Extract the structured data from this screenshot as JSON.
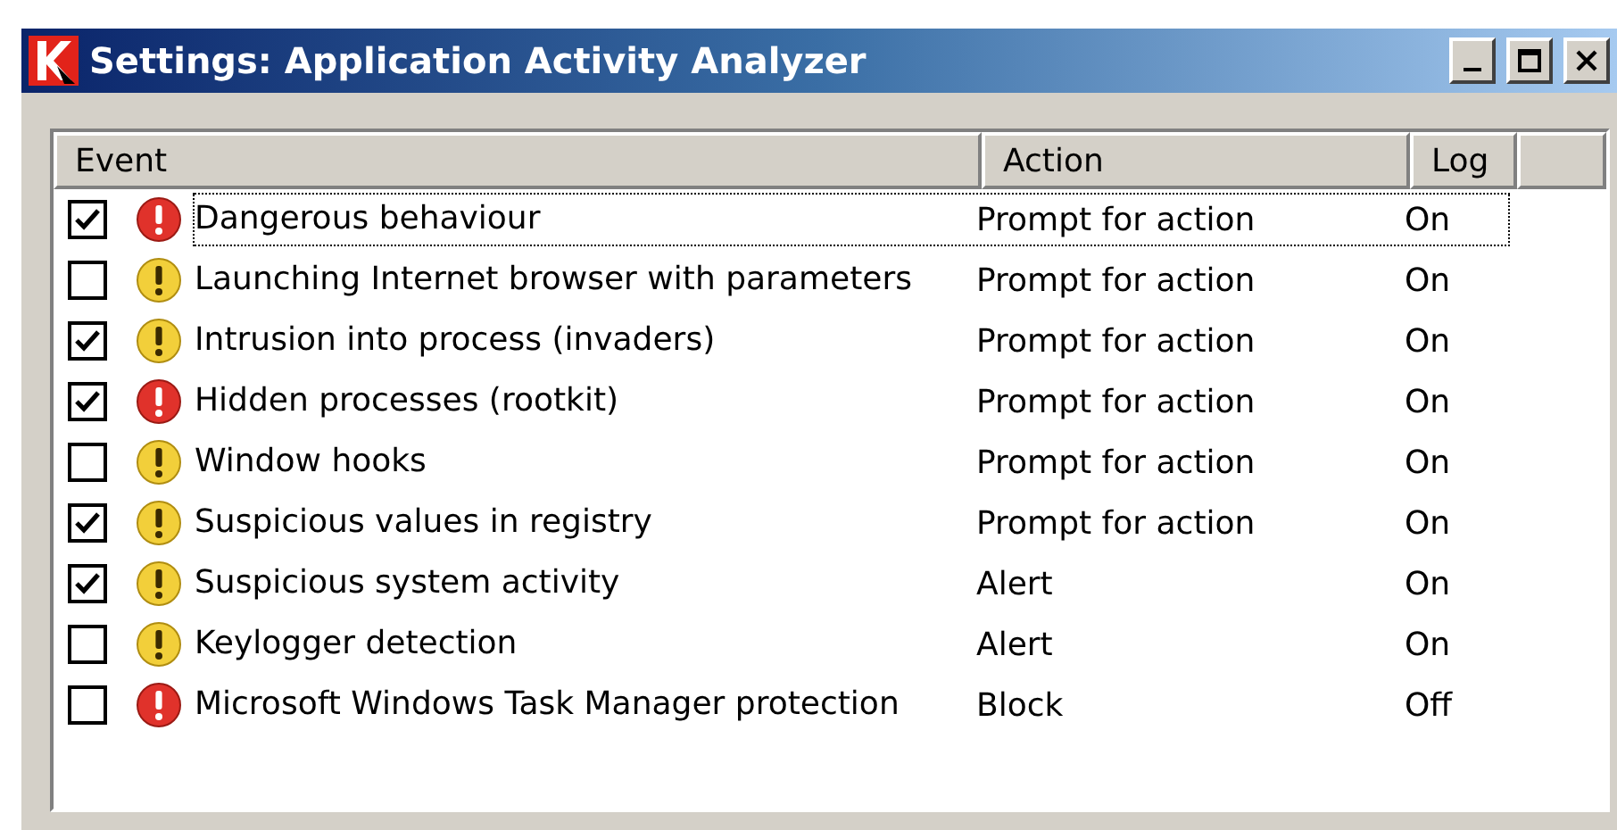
{
  "window": {
    "title": "Settings: Application Activity Analyzer"
  },
  "table": {
    "columns": [
      "Event",
      "Action",
      "Log"
    ],
    "rows": [
      {
        "checked": true,
        "kind": "danger",
        "event": "Dangerous behaviour",
        "action": "Prompt for action",
        "log": "On",
        "selected": true
      },
      {
        "checked": false,
        "kind": "warning",
        "event": "Launching Internet browser with parameters",
        "action": "Prompt for action",
        "log": "On",
        "selected": false
      },
      {
        "checked": true,
        "kind": "warning",
        "event": "Intrusion into process (invaders)",
        "action": "Prompt for action",
        "log": "On",
        "selected": false
      },
      {
        "checked": true,
        "kind": "danger",
        "event": "Hidden processes (rootkit)",
        "action": "Prompt for action",
        "log": "On",
        "selected": false
      },
      {
        "checked": false,
        "kind": "warning",
        "event": "Window hooks",
        "action": "Prompt for action",
        "log": "On",
        "selected": false
      },
      {
        "checked": true,
        "kind": "warning",
        "event": "Suspicious values in registry",
        "action": "Prompt for action",
        "log": "On",
        "selected": false
      },
      {
        "checked": true,
        "kind": "warning",
        "event": "Suspicious system activity",
        "action": "Alert",
        "log": "On",
        "selected": false
      },
      {
        "checked": false,
        "kind": "warning",
        "event": "Keylogger detection",
        "action": "Alert",
        "log": "On",
        "selected": false
      },
      {
        "checked": false,
        "kind": "danger",
        "event": "Microsoft Windows Task Manager protection",
        "action": "Block",
        "log": "Off",
        "selected": false
      }
    ]
  }
}
